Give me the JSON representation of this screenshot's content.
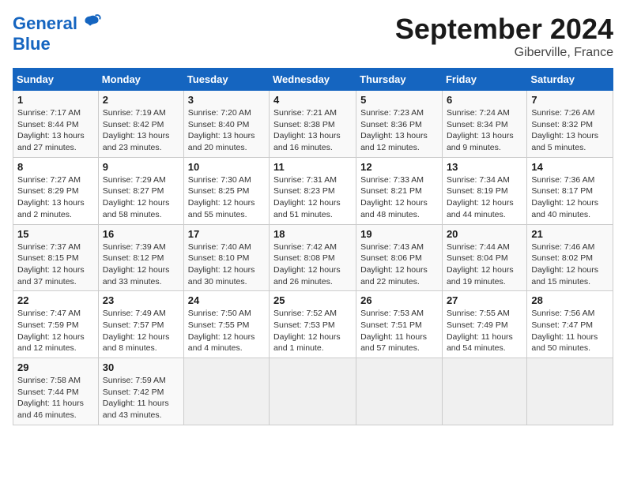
{
  "header": {
    "logo_line1": "General",
    "logo_line2": "Blue",
    "month": "September 2024",
    "location": "Giberville, France"
  },
  "weekdays": [
    "Sunday",
    "Monday",
    "Tuesday",
    "Wednesday",
    "Thursday",
    "Friday",
    "Saturday"
  ],
  "weeks": [
    [
      {
        "day": "1",
        "info": "Sunrise: 7:17 AM\nSunset: 8:44 PM\nDaylight: 13 hours\nand 27 minutes."
      },
      {
        "day": "2",
        "info": "Sunrise: 7:19 AM\nSunset: 8:42 PM\nDaylight: 13 hours\nand 23 minutes."
      },
      {
        "day": "3",
        "info": "Sunrise: 7:20 AM\nSunset: 8:40 PM\nDaylight: 13 hours\nand 20 minutes."
      },
      {
        "day": "4",
        "info": "Sunrise: 7:21 AM\nSunset: 8:38 PM\nDaylight: 13 hours\nand 16 minutes."
      },
      {
        "day": "5",
        "info": "Sunrise: 7:23 AM\nSunset: 8:36 PM\nDaylight: 13 hours\nand 12 minutes."
      },
      {
        "day": "6",
        "info": "Sunrise: 7:24 AM\nSunset: 8:34 PM\nDaylight: 13 hours\nand 9 minutes."
      },
      {
        "day": "7",
        "info": "Sunrise: 7:26 AM\nSunset: 8:32 PM\nDaylight: 13 hours\nand 5 minutes."
      }
    ],
    [
      {
        "day": "8",
        "info": "Sunrise: 7:27 AM\nSunset: 8:29 PM\nDaylight: 13 hours\nand 2 minutes."
      },
      {
        "day": "9",
        "info": "Sunrise: 7:29 AM\nSunset: 8:27 PM\nDaylight: 12 hours\nand 58 minutes."
      },
      {
        "day": "10",
        "info": "Sunrise: 7:30 AM\nSunset: 8:25 PM\nDaylight: 12 hours\nand 55 minutes."
      },
      {
        "day": "11",
        "info": "Sunrise: 7:31 AM\nSunset: 8:23 PM\nDaylight: 12 hours\nand 51 minutes."
      },
      {
        "day": "12",
        "info": "Sunrise: 7:33 AM\nSunset: 8:21 PM\nDaylight: 12 hours\nand 48 minutes."
      },
      {
        "day": "13",
        "info": "Sunrise: 7:34 AM\nSunset: 8:19 PM\nDaylight: 12 hours\nand 44 minutes."
      },
      {
        "day": "14",
        "info": "Sunrise: 7:36 AM\nSunset: 8:17 PM\nDaylight: 12 hours\nand 40 minutes."
      }
    ],
    [
      {
        "day": "15",
        "info": "Sunrise: 7:37 AM\nSunset: 8:15 PM\nDaylight: 12 hours\nand 37 minutes."
      },
      {
        "day": "16",
        "info": "Sunrise: 7:39 AM\nSunset: 8:12 PM\nDaylight: 12 hours\nand 33 minutes."
      },
      {
        "day": "17",
        "info": "Sunrise: 7:40 AM\nSunset: 8:10 PM\nDaylight: 12 hours\nand 30 minutes."
      },
      {
        "day": "18",
        "info": "Sunrise: 7:42 AM\nSunset: 8:08 PM\nDaylight: 12 hours\nand 26 minutes."
      },
      {
        "day": "19",
        "info": "Sunrise: 7:43 AM\nSunset: 8:06 PM\nDaylight: 12 hours\nand 22 minutes."
      },
      {
        "day": "20",
        "info": "Sunrise: 7:44 AM\nSunset: 8:04 PM\nDaylight: 12 hours\nand 19 minutes."
      },
      {
        "day": "21",
        "info": "Sunrise: 7:46 AM\nSunset: 8:02 PM\nDaylight: 12 hours\nand 15 minutes."
      }
    ],
    [
      {
        "day": "22",
        "info": "Sunrise: 7:47 AM\nSunset: 7:59 PM\nDaylight: 12 hours\nand 12 minutes."
      },
      {
        "day": "23",
        "info": "Sunrise: 7:49 AM\nSunset: 7:57 PM\nDaylight: 12 hours\nand 8 minutes."
      },
      {
        "day": "24",
        "info": "Sunrise: 7:50 AM\nSunset: 7:55 PM\nDaylight: 12 hours\nand 4 minutes."
      },
      {
        "day": "25",
        "info": "Sunrise: 7:52 AM\nSunset: 7:53 PM\nDaylight: 12 hours\nand 1 minute."
      },
      {
        "day": "26",
        "info": "Sunrise: 7:53 AM\nSunset: 7:51 PM\nDaylight: 11 hours\nand 57 minutes."
      },
      {
        "day": "27",
        "info": "Sunrise: 7:55 AM\nSunset: 7:49 PM\nDaylight: 11 hours\nand 54 minutes."
      },
      {
        "day": "28",
        "info": "Sunrise: 7:56 AM\nSunset: 7:47 PM\nDaylight: 11 hours\nand 50 minutes."
      }
    ],
    [
      {
        "day": "29",
        "info": "Sunrise: 7:58 AM\nSunset: 7:44 PM\nDaylight: 11 hours\nand 46 minutes."
      },
      {
        "day": "30",
        "info": "Sunrise: 7:59 AM\nSunset: 7:42 PM\nDaylight: 11 hours\nand 43 minutes."
      },
      {
        "day": "",
        "info": ""
      },
      {
        "day": "",
        "info": ""
      },
      {
        "day": "",
        "info": ""
      },
      {
        "day": "",
        "info": ""
      },
      {
        "day": "",
        "info": ""
      }
    ]
  ]
}
